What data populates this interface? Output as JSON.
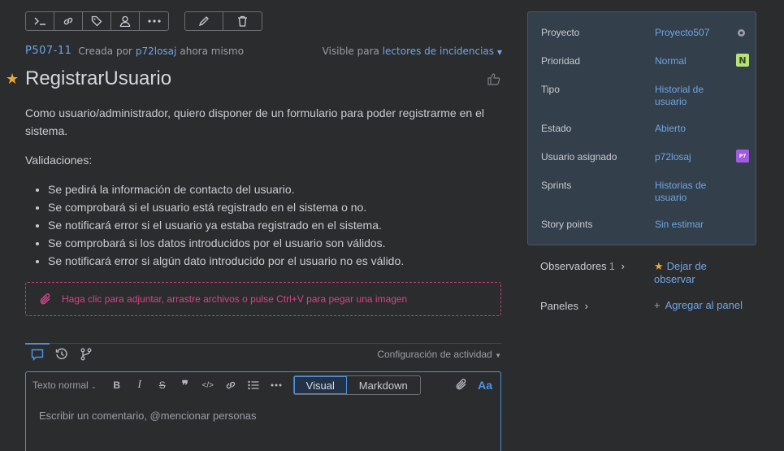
{
  "toolbar": {
    "group1": [
      "terminal-icon",
      "link-icon",
      "tag-icon",
      "user-icon",
      "more-icon"
    ],
    "group2": [
      "pencil-icon",
      "trash-icon"
    ]
  },
  "issue": {
    "key": "P507-11",
    "created_by_prefix": "Creada por",
    "author": "p72losaj",
    "created_time": "ahora mismo",
    "visible_prefix": "Visible para",
    "visible_target": "lectores de incidencias",
    "title": "RegistrarUsuario",
    "description_p1": "Como usuario/administrador, quiero disponer de un formulario para poder registrarme en el sistema.",
    "description_p2": "Validaciones:",
    "bullets": [
      "Se pedirá la información de contacto del usuario.",
      "Se comprobará si el usuario está registrado en el sistema o no.",
      "Se notificará error si el usuario ya estaba registrado en el sistema.",
      "Se comprobará si los datos introducidos por el usuario son válidos.",
      "Se notificará error si algún dato introducido por el usuario no es válido."
    ]
  },
  "attach": {
    "text": "Haga clic para adjuntar, arrastre archivos o pulse Ctrl+V para pegar una imagen"
  },
  "activity": {
    "config_label": "Configuración de actividad"
  },
  "editor": {
    "style_select": "Texto normal",
    "mode_visual": "Visual",
    "mode_markdown": "Markdown",
    "font_toggle": "Aa",
    "placeholder": "Escribir un comentario, @mencionar personas"
  },
  "fields": [
    {
      "label": "Proyecto",
      "value": "Proyecto507"
    },
    {
      "label": "Prioridad",
      "value": "Normal"
    },
    {
      "label": "Tipo",
      "value": "Historial de usuario"
    },
    {
      "label": "Estado",
      "value": "Abierto"
    },
    {
      "label": "Usuario asignado",
      "value": "p72losaj"
    },
    {
      "label": "Sprints",
      "value": "Historias de usuario"
    },
    {
      "label": "Story points",
      "value": "Sin estimar"
    }
  ],
  "priority_badge": "N",
  "assignee_avatar": "P7",
  "observers": {
    "label": "Observadores",
    "count": "1",
    "action": "Dejar de observar"
  },
  "panels": {
    "label": "Paneles",
    "action": "Agregar al panel"
  },
  "colors": {
    "accent": "#6fa6e6",
    "star": "#e8a93a",
    "attach": "#d6448a",
    "badge": "#b9e07a",
    "avatar": "#a05be0"
  }
}
